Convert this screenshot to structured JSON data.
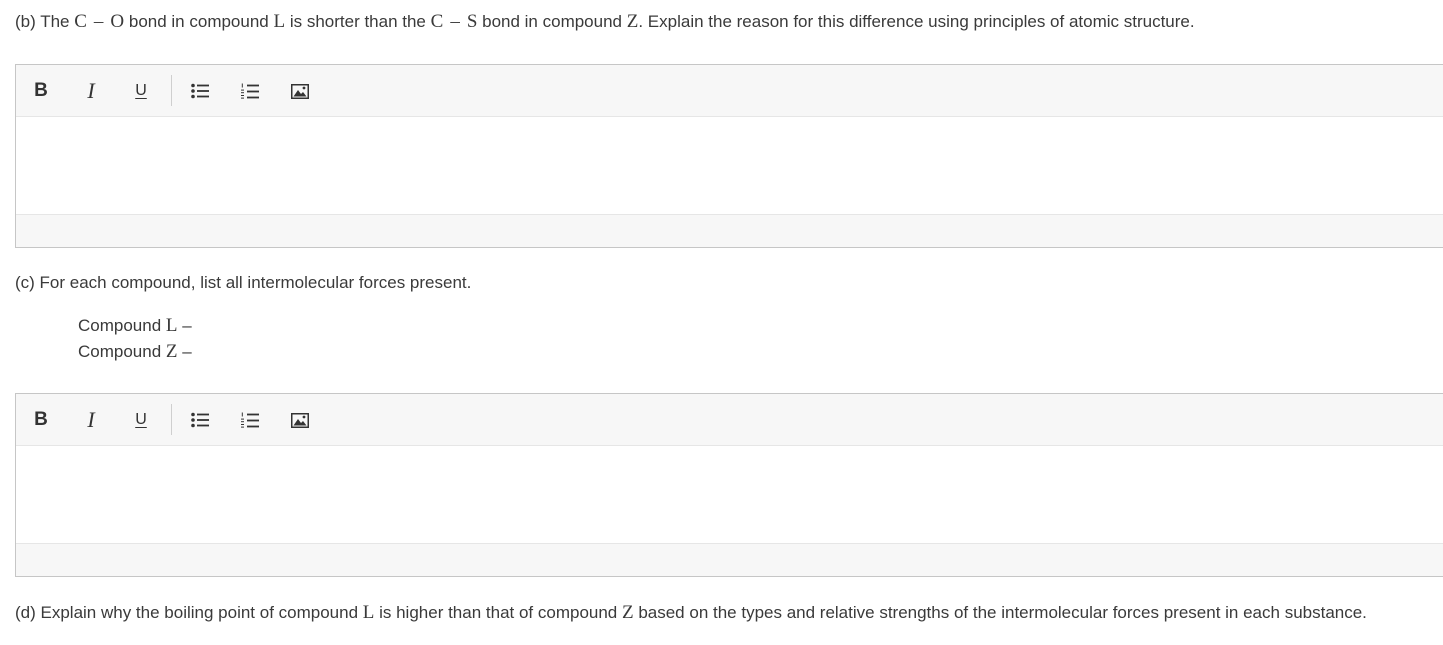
{
  "questions": {
    "b": {
      "prefix": "(b) The ",
      "c1": "C",
      "dash1": "–",
      "o": "O",
      "mid1": " bond in compound ",
      "l": "L",
      "mid2": " is shorter than the ",
      "c2": "C",
      "dash2": "–",
      "s": "S",
      "mid3": " bond in compound ",
      "z": "Z",
      "suffix": ". Explain the reason for this difference using principles of atomic structure."
    },
    "c": {
      "text": "(c) For each compound, list all intermolecular forces present.",
      "compound_l_prefix": "Compound ",
      "compound_l_symbol": "L",
      "compound_l_suffix": " –",
      "compound_z_prefix": "Compound ",
      "compound_z_symbol": "Z",
      "compound_z_suffix": " –"
    },
    "d": {
      "prefix": "(d) Explain why the boiling point of compound ",
      "l": "L",
      "mid": " is higher than that of compound ",
      "z": "Z",
      "suffix": " based on the types and relative strengths of the intermolecular forces present in each substance."
    }
  },
  "toolbar": {
    "bold_label": "B",
    "italic_label": "I",
    "underline_label": "U",
    "icons": [
      "bold-icon",
      "italic-icon",
      "underline-icon",
      "bulleted-list-icon",
      "numbered-list-icon",
      "image-icon"
    ]
  },
  "colors": {
    "text": "#3a3a3a",
    "toolbar_bg": "#f7f7f7",
    "border": "#c6c6c6"
  }
}
